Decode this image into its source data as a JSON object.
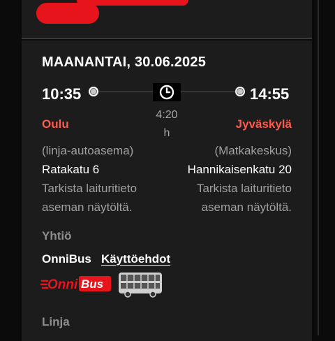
{
  "trip": {
    "date": "MAANANTAI, 30.06.2025",
    "departure": {
      "time": "10:35",
      "city": "Oulu",
      "station": "(linja-autoasema)",
      "address": "Ratakatu 6",
      "platform_note_1": "Tarkista laituritieto",
      "platform_note_2": "aseman näytöltä."
    },
    "arrival": {
      "time": "14:55",
      "city": "Jyväskylä",
      "station": "(Matkakeskus)",
      "address": "Hannikaisenkatu 20",
      "platform_note_1": "Tarkista laituritieto",
      "platform_note_2": "aseman näytöltä."
    },
    "duration_value": "4:20",
    "duration_unit": "h"
  },
  "company": {
    "section_label": "Yhtiö",
    "name": "OnniBus",
    "terms_link": "Käyttöehdot",
    "logo_text": "OnniBus"
  },
  "line": {
    "section_label": "Linja"
  },
  "icons": {
    "clock": "clock-icon",
    "bus": "double-decker-bus-icon",
    "route_dot": "route-stop-dot-icon"
  },
  "colors": {
    "background": "#0b0b0b",
    "card": "#1c1c1c",
    "accent_city": "#ff5a4e",
    "redaction": "#e8141c",
    "muted_text": "#a0a0a0"
  }
}
